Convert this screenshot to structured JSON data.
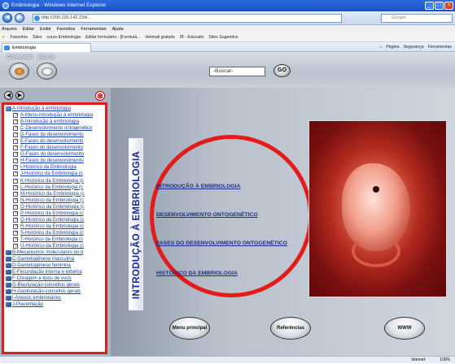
{
  "window": {
    "title": "Embriologia - Windows Internet Explorer",
    "url": "http://200.195.142.234/...",
    "search_engine": "Google"
  },
  "menubar": [
    "Arquivo",
    "Editar",
    "Exibir",
    "Favoritos",
    "Ferramentas",
    "Ajuda"
  ],
  "favorites": {
    "label": "Favoritos",
    "items": [
      "Sites",
      "curso Embriologia",
      "Editar formulário - [Formulá...",
      "Hotmail gratuito",
      "IB - Educativ",
      "Sites Sugeridos"
    ]
  },
  "tab": {
    "label": "Embriologia"
  },
  "commandbar": [
    "Página",
    "Segurança",
    "Ferramentas"
  ],
  "app": {
    "logo_conteudo": "Conteúdo",
    "logo_busca": "Busca",
    "search_value": "-Buscar-",
    "go_label": "GO"
  },
  "tree": {
    "items": [
      {
        "kind": "top",
        "label": "A-Introdução à embriologia"
      },
      {
        "kind": "sub",
        "label": "A-Menu-Introdução à embriologia"
      },
      {
        "kind": "sub",
        "label": "B-Introdução à embriologia"
      },
      {
        "kind": "sub",
        "label": "C-Desenvolvimento ontogenético"
      },
      {
        "kind": "sub",
        "label": "D-Fases do desenvolvimento"
      },
      {
        "kind": "sub",
        "label": "E-Fases do desenvolvimento"
      },
      {
        "kind": "sub",
        "label": "F-Fases do desenvolvimento"
      },
      {
        "kind": "sub",
        "label": "G-Fases do desenvolvimento"
      },
      {
        "kind": "sub",
        "label": "H-Fases do desenvolvimento"
      },
      {
        "kind": "sub",
        "label": "I-Histórico da Embriologia"
      },
      {
        "kind": "sub",
        "label": "J-Histórico da Embriologia (c"
      },
      {
        "kind": "sub",
        "label": "K-Histórico da Embriologia (c"
      },
      {
        "kind": "sub",
        "label": "L-Histórico da Embriologia (c"
      },
      {
        "kind": "sub",
        "label": "M-Histórico da Embriologia (c"
      },
      {
        "kind": "sub",
        "label": "N-Histórico da Embriologia (c"
      },
      {
        "kind": "sub",
        "label": "O-Histórico da Embriologia (c"
      },
      {
        "kind": "sub",
        "label": "P-Histórico da Embriologia (c"
      },
      {
        "kind": "sub",
        "label": "Q-Histórico da Embriologia (c"
      },
      {
        "kind": "sub",
        "label": "R-Histórico da Embriologia (c"
      },
      {
        "kind": "sub",
        "label": "S-Histórico da Embriologia (c"
      },
      {
        "kind": "sub",
        "label": "T-Histórico da Embriologia (c"
      },
      {
        "kind": "sub",
        "label": "U-Histórico da Embriologia (c"
      },
      {
        "kind": "grp",
        "label": "B-Mecanismos moleculares do d"
      },
      {
        "kind": "grp",
        "label": "C-Gametogênese masculina"
      },
      {
        "kind": "grp",
        "label": "D-Gametogênese feminina"
      },
      {
        "kind": "grp",
        "label": "E-Fecundação interna e externa"
      },
      {
        "kind": "grp",
        "label": "F-Clivagem e tipos de ovos"
      },
      {
        "kind": "grp",
        "label": "G-Blastulação-conceitos gerais"
      },
      {
        "kind": "grp",
        "label": "H-Gastrulação-conceitos gerais"
      },
      {
        "kind": "grp",
        "label": "I-Anexos embrionários"
      },
      {
        "kind": "grp",
        "label": "J-Placentação"
      }
    ]
  },
  "main": {
    "vertical_title": "INTRODUÇÃO À EMBRIOLOGIA",
    "links": [
      "INTRODUÇÃO À EMBRIOLOGIA",
      "DESENVOLVIMENTO  ONTOGENÉTICO",
      "FASES DO DESENVOLVIMENTO ONTOGENÉTICO",
      "HISTÓRICO DA EMBRIOLOGIA"
    ],
    "buttons": {
      "menu": "Menu principal",
      "refs": "Referências",
      "www": "WWW"
    }
  },
  "status": {
    "zone": "Internet",
    "zoom": "100%"
  },
  "colors": {
    "highlight": "#e01d1d",
    "link": "#1d2c8a"
  }
}
